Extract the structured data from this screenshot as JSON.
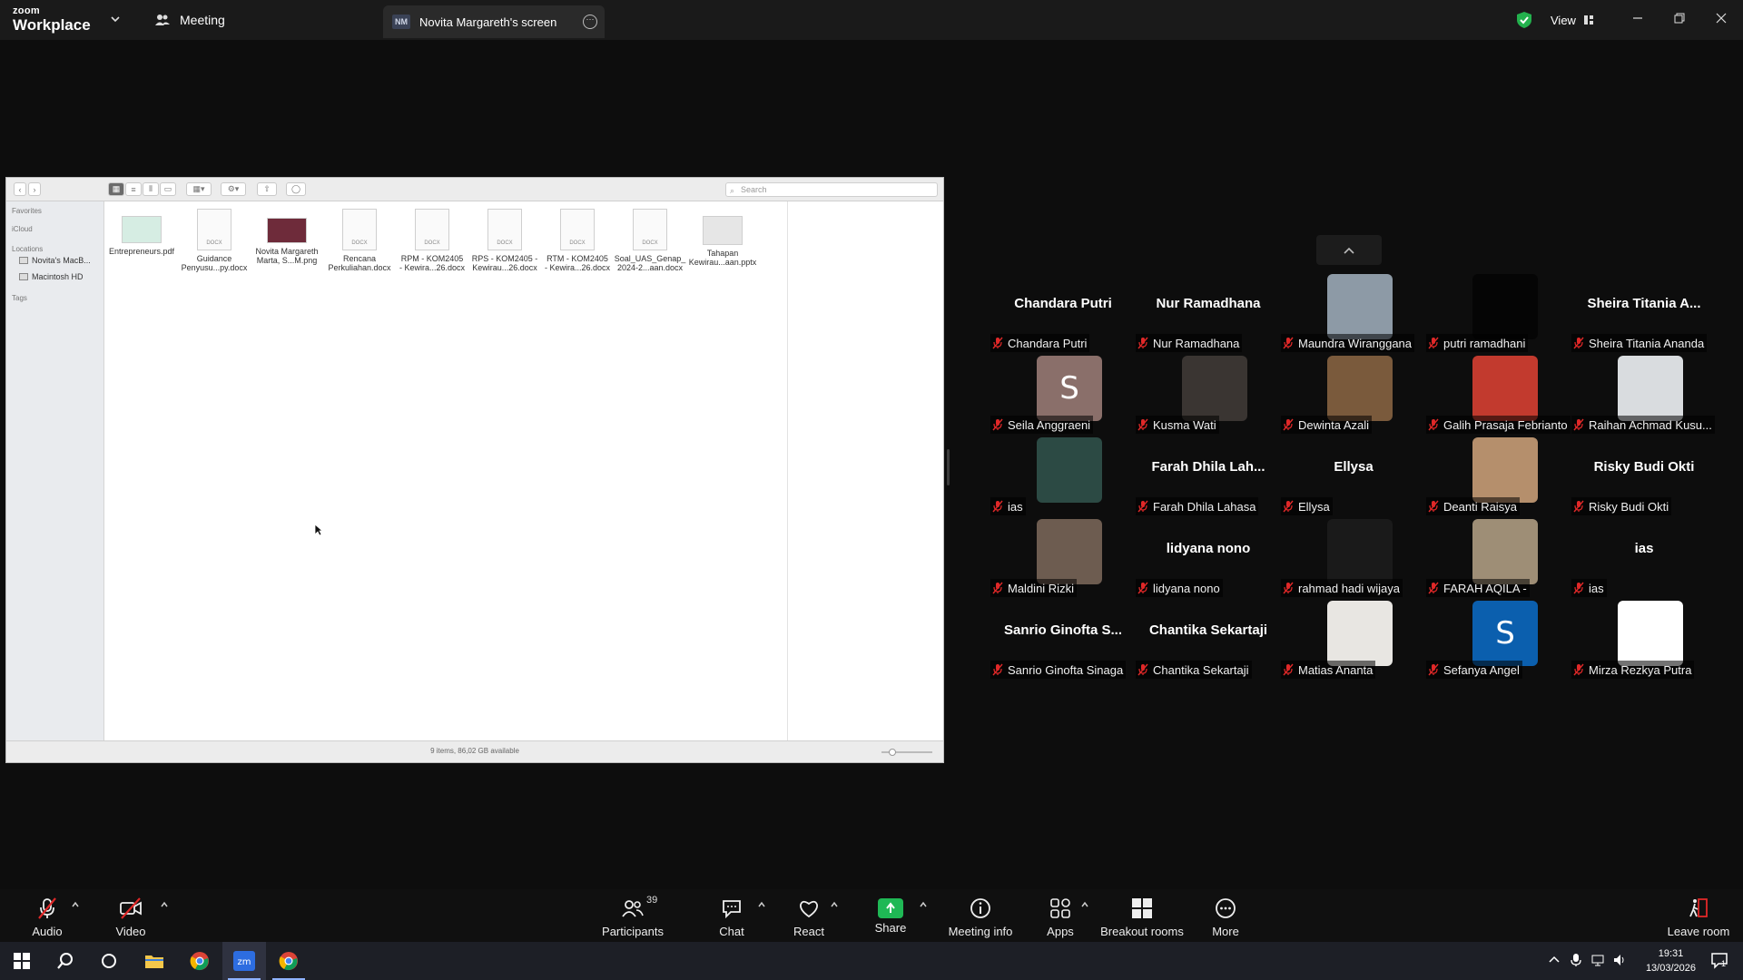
{
  "topbar": {
    "logo_line1": "zoom",
    "logo_line2": "Workplace",
    "meeting_tab": "Meeting",
    "share_badge": "NM",
    "share_tab": "Novita Margareth's screen",
    "view_label": "View"
  },
  "finder": {
    "search_placeholder": "Search",
    "sidebar": {
      "favorites": "Favorites",
      "icloud": "iCloud",
      "locations": "Locations",
      "loc1": "Novita's MacB...",
      "loc2": "Macintosh HD",
      "tags": "Tags"
    },
    "files": [
      {
        "line1": "Entrepreneurs.pdf",
        "line2": "",
        "kind": "pdf"
      },
      {
        "line1": "Guidance",
        "line2": "Penyusu...py.docx",
        "kind": "doc"
      },
      {
        "line1": "Novita Margareth",
        "line2": "Marta, S...M.png",
        "kind": "img"
      },
      {
        "line1": "Rencana",
        "line2": "Perkuliahan.docx",
        "kind": "doc"
      },
      {
        "line1": "RPM - KOM2405",
        "line2": "- Kewira...26.docx",
        "kind": "doc"
      },
      {
        "line1": "RPS - KOM2405 -",
        "line2": "Kewirau...26.docx",
        "kind": "doc"
      },
      {
        "line1": "RTM - KOM2405",
        "line2": "- Kewira...26.docx",
        "kind": "doc"
      },
      {
        "line1": "Soal_UAS_Genap_",
        "line2": "2024-2...aan.docx",
        "kind": "doc"
      },
      {
        "line1": "Tahapan",
        "line2": "Kewirau...aan.pptx",
        "kind": "ppt"
      }
    ],
    "status": "9 items, 86,02 GB available"
  },
  "participants": [
    {
      "big": "Chandara Putri",
      "label": "Chandara Putri",
      "photo": null
    },
    {
      "big": "Nur Ramadhana",
      "label": "Nur Ramadhana",
      "photo": null
    },
    {
      "big": "",
      "label": "Maundra Wiranggana",
      "photo": "#8d9aa6"
    },
    {
      "big": "",
      "label": "putri ramadhani",
      "photo": "#050505"
    },
    {
      "big": "Sheira Titania A...",
      "label": "Sheira Titania Ananda",
      "photo": null
    },
    {
      "big": "",
      "label": "Seila Anggraeni",
      "photo": "#8a6f6a",
      "letter": "S"
    },
    {
      "big": "",
      "label": "Kusma Wati",
      "photo": "#3a3532"
    },
    {
      "big": "",
      "label": "Dewinta Azali",
      "photo": "#7a5a3c"
    },
    {
      "big": "",
      "label": "Galih Prasaja Febrianto",
      "photo": "#c23a2e"
    },
    {
      "big": "",
      "label": "Raihan Achmad Kusu...",
      "photo": "#d9dcdf"
    },
    {
      "big": "",
      "label": "ias",
      "photo": "#2c4a44"
    },
    {
      "big": "Farah Dhila Lah...",
      "label": "Farah Dhila Lahasa",
      "photo": null
    },
    {
      "big": "Ellysa",
      "label": "Ellysa",
      "photo": null
    },
    {
      "big": "",
      "label": "Deanti Raisya",
      "photo": "#b58f6c"
    },
    {
      "big": "Risky Budi Okti",
      "label": "Risky Budi Okti",
      "photo": null
    },
    {
      "big": "",
      "label": "Maldini Rizki",
      "photo": "#6d5c50"
    },
    {
      "big": "lidyana nono",
      "label": "lidyana nono",
      "photo": null
    },
    {
      "big": "",
      "label": "rahmad hadi wijaya",
      "photo": "#1a1a1a"
    },
    {
      "big": "",
      "label": "FARAH AQILA -",
      "photo": "#9e8e76"
    },
    {
      "big": "ias",
      "label": "ias",
      "photo": null
    },
    {
      "big": "Sanrio Ginofta S...",
      "label": "Sanrio Ginofta Sinaga",
      "photo": null
    },
    {
      "big": "Chantika Sekartaji",
      "label": "Chantika Sekartaji",
      "photo": null
    },
    {
      "big": "",
      "label": "Matias Ananta",
      "photo": "#e8e6e2"
    },
    {
      "big": "",
      "label": "Sefanya Angel",
      "photo": "#0b5fae",
      "letter": "S"
    },
    {
      "big": "",
      "label": "Mirza Rezkya Putra",
      "photo": "#ffffff"
    }
  ],
  "toolbar": {
    "audio": "Audio",
    "video": "Video",
    "participants": "Participants",
    "participants_count": "39",
    "chat": "Chat",
    "react": "React",
    "share": "Share",
    "meeting_info": "Meeting info",
    "apps": "Apps",
    "breakout": "Breakout rooms",
    "more": "More",
    "leave": "Leave room"
  },
  "taskbar": {
    "time": "19:31",
    "date": "13/03/2026",
    "notification_count": "1"
  },
  "colors": {
    "share_green": "#1fb855",
    "mic_off_red": "#e02828",
    "leave_red": "#e02828"
  }
}
